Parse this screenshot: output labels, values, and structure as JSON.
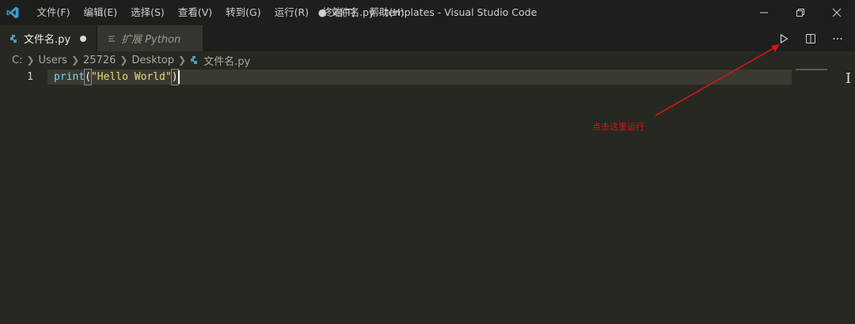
{
  "titlebar": {
    "menu": [
      {
        "label": "文件(F)"
      },
      {
        "label": "编辑(E)"
      },
      {
        "label": "选择(S)"
      },
      {
        "label": "查看(V)"
      },
      {
        "label": "转到(G)"
      },
      {
        "label": "运行(R)"
      },
      {
        "label": "终端(T)"
      },
      {
        "label": "帮助(H)"
      }
    ],
    "window_title": "● 文件名.py - templates - Visual Studio Code"
  },
  "tabs": [
    {
      "label": "文件名.py",
      "dirty": true,
      "active": true
    },
    {
      "label": "扩展 Python",
      "active": false
    }
  ],
  "breadcrumb": {
    "parts": [
      "C:",
      "Users",
      "25726",
      "Desktop"
    ],
    "file": "文件名.py"
  },
  "editor": {
    "line_number": "1",
    "code": {
      "fn": "print",
      "open": "(",
      "string": "\"Hello World\"",
      "close": ")"
    }
  },
  "annotation": {
    "text": "点击这里运行",
    "color": "#d01818"
  },
  "colors": {
    "vscode_blue": "#3c99d4",
    "python_icon": "#519aba",
    "background": "#272822"
  }
}
